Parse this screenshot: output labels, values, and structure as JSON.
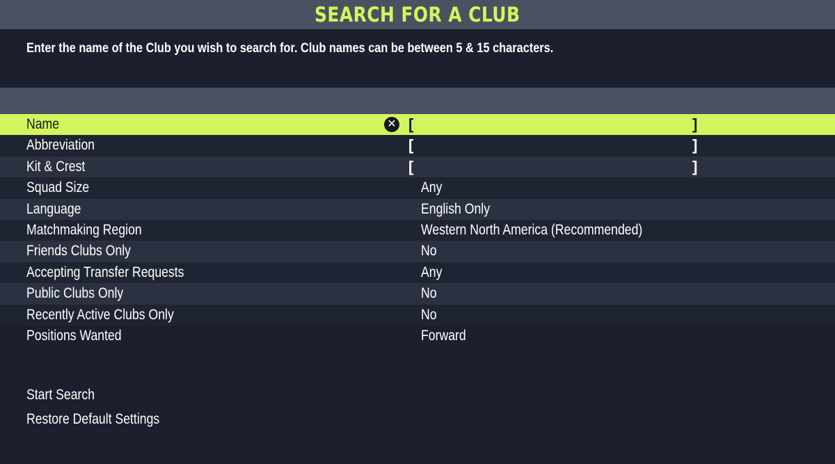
{
  "header": {
    "title": "SEARCH FOR A CLUB"
  },
  "intro": {
    "text": "Enter the name of the Club you wish to search for. Club names can be between 5 & 15 characters."
  },
  "colors": {
    "accent": "#d4f45d",
    "panel": "#4a5261",
    "background": "#1b1f2e"
  },
  "form": {
    "rows": [
      {
        "label": "Name",
        "type": "text",
        "value": "",
        "selected": true,
        "clear_icon": "close-icon"
      },
      {
        "label": "Abbreviation",
        "type": "text",
        "value": ""
      },
      {
        "label": "Kit & Crest",
        "type": "text",
        "value": ""
      },
      {
        "label": "Squad Size",
        "type": "option",
        "value": "Any"
      },
      {
        "label": "Language",
        "type": "option",
        "value": "English Only"
      },
      {
        "label": "Matchmaking Region",
        "type": "option",
        "value": "Western North America (Recommended)"
      },
      {
        "label": "Friends Clubs Only",
        "type": "option",
        "value": "No"
      },
      {
        "label": "Accepting Transfer Requests",
        "type": "option",
        "value": "Any"
      },
      {
        "label": "Public Clubs Only",
        "type": "option",
        "value": "No"
      },
      {
        "label": "Recently Active Clubs Only",
        "type": "option",
        "value": "No"
      },
      {
        "label": "Positions Wanted",
        "type": "option",
        "value": "Forward"
      }
    ],
    "bracket_open": "[",
    "bracket_close": "]"
  },
  "actions": {
    "start_search": "Start Search",
    "restore_defaults": "Restore Default Settings"
  }
}
